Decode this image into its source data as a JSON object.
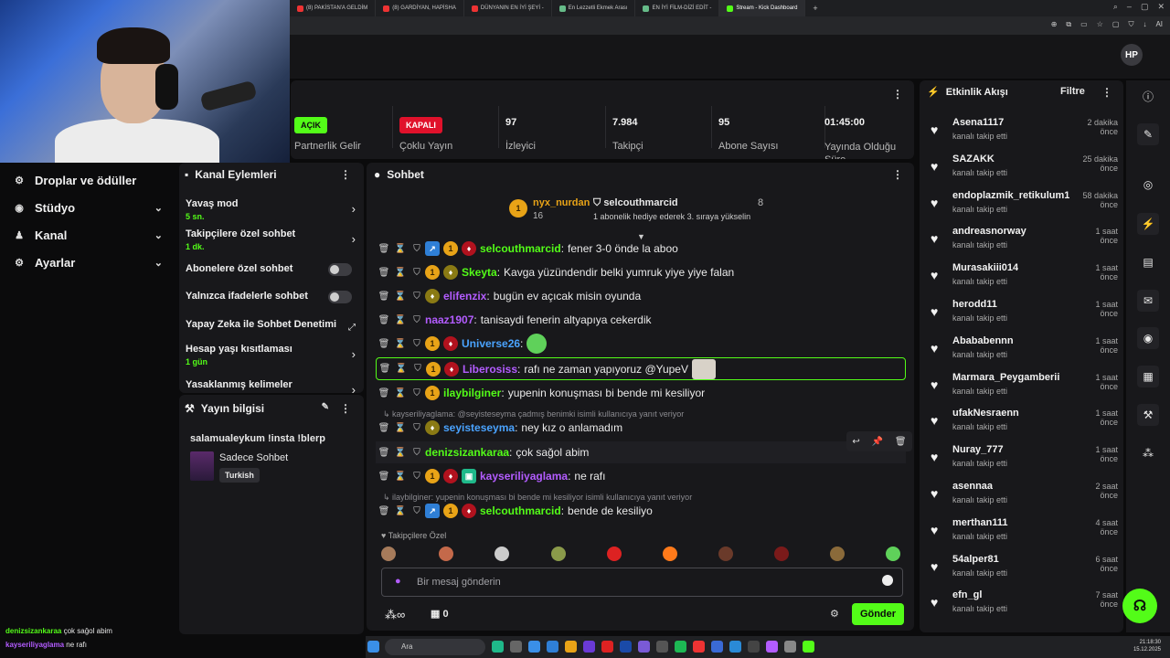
{
  "browser": {
    "tabs": [
      "(8) PAKİSTAN'A GELDİM",
      "(8) GARDİYAN, HAPİSHA",
      "DÜNYANIN EN İYİ ŞEYİ -",
      "En Lezzetli Ekmek Arası",
      "EN İYİ FİLM-DİZİ EDİT -",
      "Stream - Kick Dashboard"
    ],
    "new_tab": "+",
    "ai_label": "AI"
  },
  "left_nav": [
    {
      "label": "Droplar ve ödüller",
      "icon": "gift-icon",
      "glyph": "⚙"
    },
    {
      "label": "Stüdyo",
      "icon": "studio-icon",
      "glyph": "◉"
    },
    {
      "label": "Kanal",
      "icon": "channel-icon",
      "glyph": "♟"
    },
    {
      "label": "Ayarlar",
      "icon": "settings-icon",
      "glyph": "⚙"
    }
  ],
  "stats": {
    "partner": {
      "badge": "AÇIK",
      "label": "Partnerlik Gelir"
    },
    "multistream": {
      "badge": "KAPALI",
      "label": "Çoklu Yayın"
    },
    "viewers": {
      "value": "97",
      "label": "İzleyici"
    },
    "followers": {
      "value": "7.984",
      "label": "Takipçi"
    },
    "subs": {
      "value": "95",
      "label": "Abone Sayısı"
    },
    "uptime": {
      "value": "01:45:00",
      "label": "Yayında Olduğu Süre"
    }
  },
  "channel_actions": {
    "title": "Kanal Eylemleri",
    "items": [
      {
        "label": "Yavaş mod",
        "sub": "5 sn.",
        "control": "chevron"
      },
      {
        "label": "Takipçilere özel sohbet",
        "sub": "1 dk.",
        "control": "chevron"
      },
      {
        "label": "Abonelere özel sohbet",
        "sub": "",
        "control": "toggle"
      },
      {
        "label": "Yalnızca ifadelerle sohbet",
        "sub": "",
        "control": "toggle"
      },
      {
        "label": "Yapay Zeka ile Sohbet Denetimi",
        "sub": "",
        "control": "chart"
      },
      {
        "label": "Hesap yaşı kısıtlaması",
        "sub": "1 gün",
        "control": "chevron"
      },
      {
        "label": "Yasaklanmış kelimeler",
        "sub": "",
        "control": "chevron"
      }
    ]
  },
  "stream_info": {
    "title": "Yayın bilgisi",
    "stream_title": "salamualeykum !insta !blerp",
    "category": "Sadece Sohbet",
    "language": "Turkish"
  },
  "chat": {
    "title": "Sohbet",
    "pinned": {
      "gifter": "nyx_nurdan",
      "gifter_count": "16",
      "recipient": "selcouthmarcid",
      "recipient_count": "8",
      "message": "1 abonelik hediye ederek 3. sıraya yükselin"
    },
    "messages": [
      {
        "user": "selcouthmarcid",
        "color": "#53fc18",
        "text": "fener 3-0 önde la aboo",
        "badges": [
          "blue",
          "gold",
          "red"
        ],
        "reply": "",
        "emote": ""
      },
      {
        "user": "Skeyta",
        "color": "#53fc18",
        "text": "Kavga yüzündendir belki yumruk yiye yiye falan",
        "badges": [
          "gold",
          "olive"
        ],
        "reply": "",
        "emote": ""
      },
      {
        "user": "elifenzix",
        "color": "#b35cff",
        "text": "bugün ev açıcak misin oyunda",
        "badges": [
          "olive"
        ],
        "reply": "",
        "emote": ""
      },
      {
        "user": "naaz1907",
        "color": "#b35cff",
        "text": "tanisaydi fenerin altyapıya cekerdik",
        "badges": [],
        "reply": "",
        "emote": ""
      },
      {
        "user": "Universe26",
        "color": "#4aa3ff",
        "text": "",
        "badges": [
          "gold",
          "red"
        ],
        "reply": "",
        "emote": "green"
      },
      {
        "user": "Liberosiss",
        "color": "#b35cff",
        "text": "rafı ne zaman yapıyoruz @YupeV",
        "badges": [
          "gold",
          "red"
        ],
        "reply": "",
        "emote": "cat"
      },
      {
        "user": "ilaybilginer",
        "color": "#53fc18",
        "text": "yupenin konuşması bi bende mi kesiliyor",
        "badges": [
          "gold"
        ],
        "reply": "",
        "emote": ""
      },
      {
        "user": "seyisteseyma",
        "color": "#4aa3ff",
        "text": "ney kız o anlamadım",
        "badges": [
          "olive"
        ],
        "reply": "kayseriliyaglama: @seyisteseyma çadmış benimki isimli kullanıcıya yanıt veriyor",
        "emote": ""
      },
      {
        "user": "denizsizankaraa",
        "color": "#53fc18",
        "text": "çok sağol abim",
        "badges": [],
        "reply": "",
        "emote": ""
      },
      {
        "user": "kayseriliyaglama",
        "color": "#b35cff",
        "text": "ne rafı",
        "badges": [
          "gold",
          "red",
          "teal"
        ],
        "reply": "",
        "emote": ""
      },
      {
        "user": "selcouthmarcid",
        "color": "#53fc18",
        "text": "bende de kesiliyo",
        "badges": [
          "blue",
          "gold",
          "red"
        ],
        "reply": "ilaybilginer: yupenin konuşması bi bende mi kesiliyor isimli kullanıcıya yanıt veriyor",
        "emote": ""
      }
    ],
    "followers_only_label": "Takipçilere Özel",
    "input_placeholder": "Bir mesaj gönderin",
    "infinite_label": "∞",
    "gift_count": "0",
    "send_label": "Gönder"
  },
  "activity": {
    "title": "Etkinlik Akışı",
    "filter_label": "Filtre",
    "events": [
      {
        "name": "Asena1117",
        "action": "kanalı takip etti",
        "time": "2 dakika önce"
      },
      {
        "name": "SAZAKK",
        "action": "kanalı takip etti",
        "time": "25 dakika önce"
      },
      {
        "name": "endoplazmik_retikulum1",
        "action": "kanalı takip etti",
        "time": "58 dakika önce"
      },
      {
        "name": "andreasnorway",
        "action": "kanalı takip etti",
        "time": "1 saat önce"
      },
      {
        "name": "Murasakiii014",
        "action": "kanalı takip etti",
        "time": "1 saat önce"
      },
      {
        "name": "herodd11",
        "action": "kanalı takip etti",
        "time": "1 saat önce"
      },
      {
        "name": "Abababennn",
        "action": "kanalı takip etti",
        "time": "1 saat önce"
      },
      {
        "name": "Marmara_Peygamberii",
        "action": "kanalı takip etti",
        "time": "1 saat önce"
      },
      {
        "name": "ufakNesraenn",
        "action": "kanalı takip etti",
        "time": "1 saat önce"
      },
      {
        "name": "Nuray_777",
        "action": "kanalı takip etti",
        "time": "1 saat önce"
      },
      {
        "name": "asennaa",
        "action": "kanalı takip etti",
        "time": "2 saat önce"
      },
      {
        "name": "merthan111",
        "action": "kanalı takip etti",
        "time": "4 saat önce"
      },
      {
        "name": "54alper81",
        "action": "kanalı takip etti",
        "time": "6 saat önce"
      },
      {
        "name": "efn_gl",
        "action": "kanalı takip etti",
        "time": "7 saat önce"
      }
    ]
  },
  "overlay_chat": [
    {
      "user": "denizsizankaraa",
      "text": "çok sağol abim"
    },
    {
      "user": "kayseriliyaglama",
      "text": "ne rafı"
    }
  ],
  "taskbar": {
    "search": "Ara",
    "time": "21:18:30",
    "date": "15.12.2025"
  },
  "colors": {
    "accent": "#53fc18",
    "danger": "#e0112b",
    "panel": "#18181b",
    "bg": "#0b0b0c"
  }
}
